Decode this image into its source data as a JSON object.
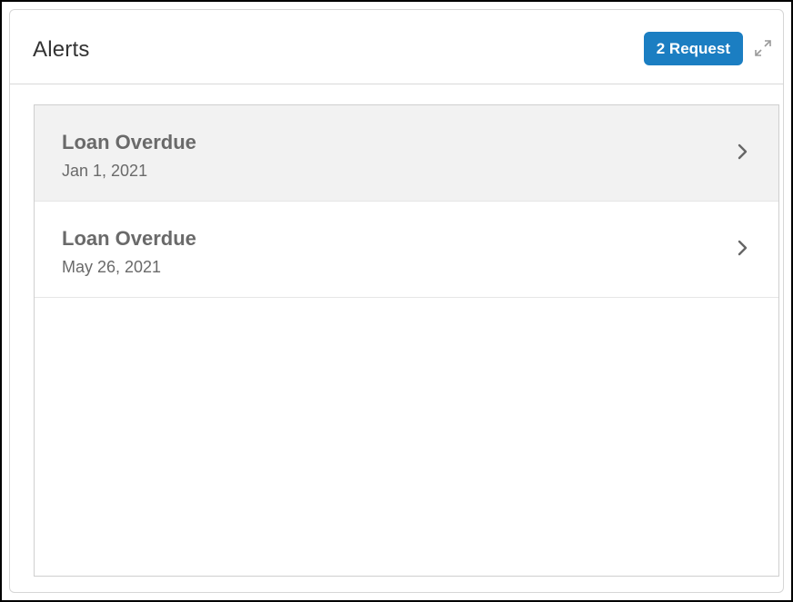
{
  "widget": {
    "title": "Alerts",
    "badge_label": "2 Request",
    "accent_color": "#1b7ec2"
  },
  "alerts": [
    {
      "title": "Loan Overdue",
      "date": "Jan 1, 2021",
      "selected": true,
      "icon": "chevron-right-icon"
    },
    {
      "title": "Loan Overdue",
      "date": "May 26, 2021",
      "selected": false,
      "icon": "chevron-right-icon"
    }
  ],
  "icons": {
    "expand": "expand-icon"
  }
}
